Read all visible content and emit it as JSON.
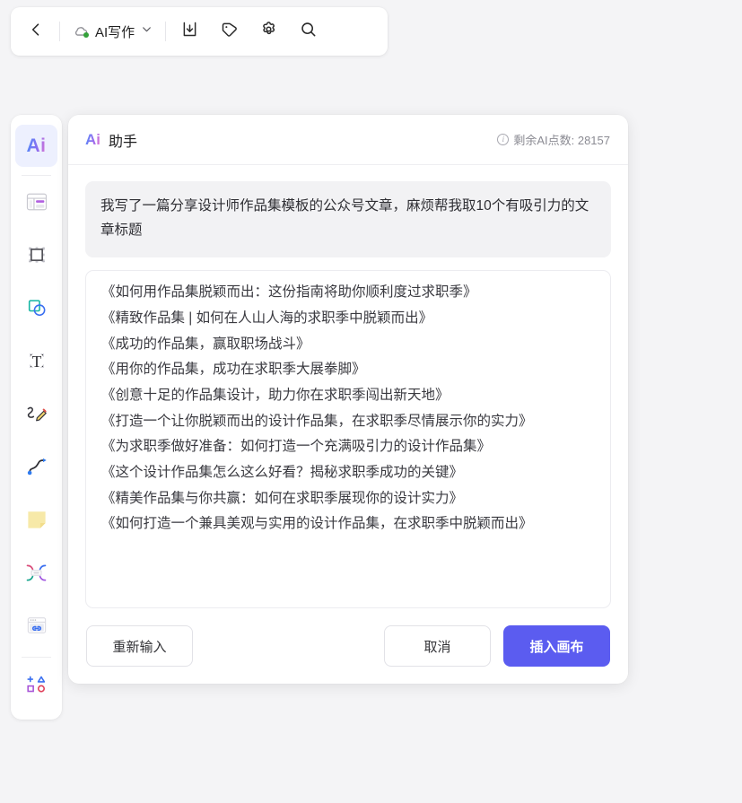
{
  "toolbar": {
    "back_label": "back",
    "doc_title": "AI写作",
    "cloud_status": "synced",
    "icons": {
      "back": "chevron-left-icon",
      "cloud": "cloud-sync-icon",
      "chevron": "chevron-down-icon",
      "import": "import-download-icon",
      "tag": "tag-icon",
      "settings": "gear-icon",
      "search": "search-icon"
    }
  },
  "left_toolbar": {
    "items": [
      {
        "name": "ai",
        "label": "Ai",
        "icon": "ai-icon",
        "active": true
      },
      {
        "name": "template",
        "label": "模板",
        "icon": "template-icon",
        "active": false
      },
      {
        "name": "frame",
        "label": "画框",
        "icon": "frame-icon",
        "active": false
      },
      {
        "name": "shape",
        "label": "形状",
        "icon": "shape-icon",
        "active": false
      },
      {
        "name": "text",
        "label": "文字",
        "icon": "text-icon",
        "active": false
      },
      {
        "name": "pen",
        "label": "画笔",
        "icon": "pen-icon",
        "active": false
      },
      {
        "name": "curve",
        "label": "曲线",
        "icon": "curve-icon",
        "active": false
      },
      {
        "name": "sticky",
        "label": "便签",
        "icon": "sticky-note-icon",
        "active": false
      },
      {
        "name": "connector",
        "label": "连线",
        "icon": "connector-icon",
        "active": false
      },
      {
        "name": "embed",
        "label": "嵌入",
        "icon": "embed-link-icon",
        "active": false
      },
      {
        "name": "more",
        "label": "更多",
        "icon": "more-shapes-icon",
        "active": false
      }
    ]
  },
  "ai_panel": {
    "logo": "Ai",
    "title": "助手",
    "credits_label": "剩余AI点数: 28157",
    "prompt": "我写了一篇分享设计师作品集模板的公众号文章，麻烦帮我取10个有吸引力的文章标题",
    "results": [
      "《如何用作品集脱颖而出：这份指南将助你顺利度过求职季》",
      "《精致作品集 | 如何在人山人海的求职季中脱颖而出》",
      "《成功的作品集，赢取职场战斗》",
      "《用你的作品集，成功在求职季大展拳脚》",
      "《创意十足的作品集设计，助力你在求职季闯出新天地》",
      "《打造一个让你脱颖而出的设计作品集，在求职季尽情展示你的实力》",
      "《为求职季做好准备：如何打造一个充满吸引力的设计作品集》",
      "《这个设计作品集怎么这么好看？揭秘求职季成功的关键》",
      "《精美作品集与你共赢：如何在求职季展现你的设计实力》",
      "《如何打造一个兼具美观与实用的设计作品集，在求职季中脱颖而出》"
    ],
    "buttons": {
      "retry": "重新输入",
      "cancel": "取消",
      "insert": "插入画布"
    }
  },
  "colors": {
    "primary": "#5b5cf0",
    "page_bg": "#f4f4f6",
    "panel_bg": "#ffffff",
    "prompt_bg": "#f2f2f4",
    "active_tool_bg": "#edf0fe",
    "sync_dot": "#34a13a"
  }
}
